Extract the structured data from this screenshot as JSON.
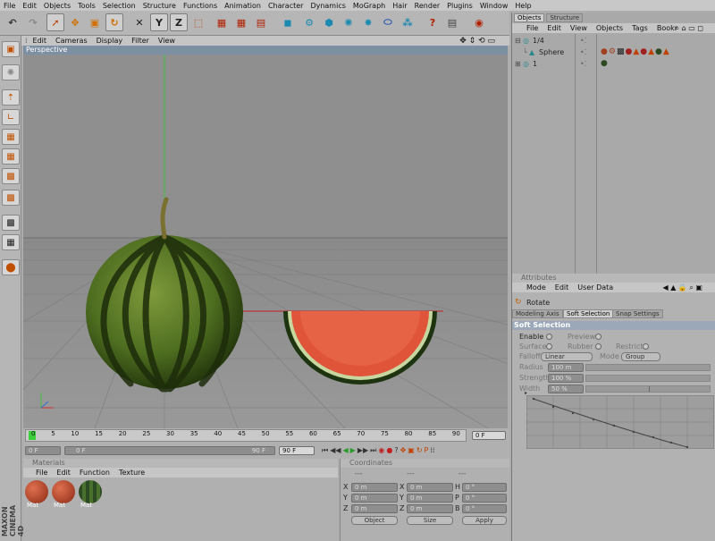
{
  "menu": [
    "File",
    "Edit",
    "Objects",
    "Tools",
    "Selection",
    "Structure",
    "Functions",
    "Animation",
    "Character",
    "Dynamics",
    "MoGraph",
    "Hair",
    "Render",
    "Plugins",
    "Window",
    "Help"
  ],
  "viewport": {
    "menu": [
      "Edit",
      "Cameras",
      "Display",
      "Filter",
      "View"
    ],
    "label": "Perspective"
  },
  "timeline": {
    "ticks": [
      "0",
      "5",
      "10",
      "15",
      "20",
      "25",
      "30",
      "35",
      "40",
      "45",
      "50",
      "55",
      "60",
      "65",
      "70",
      "75",
      "80",
      "85",
      "90"
    ],
    "current_frame": "0 F",
    "start_field": "0 F",
    "slider_left": "0 F",
    "slider_right": "90 F",
    "end_field": "90 F"
  },
  "materials": {
    "title": "Materials",
    "menu": [
      "File",
      "Edit",
      "Function",
      "Texture"
    ],
    "items": [
      {
        "label": "Mat",
        "color": "#b04a2a"
      },
      {
        "label": "Mat",
        "color": "#b04a2a"
      },
      {
        "label": "Mat",
        "color": "#2c4a22"
      }
    ]
  },
  "coordinates": {
    "title": "Coordinates",
    "header": [
      "---",
      "---",
      "---"
    ],
    "rows": [
      {
        "a": "X",
        "av": "0 m",
        "b": "X",
        "bv": "0 m",
        "c": "H",
        "cv": "0 °"
      },
      {
        "a": "Y",
        "av": "0 m",
        "b": "Y",
        "bv": "0 m",
        "c": "P",
        "cv": "0 °"
      },
      {
        "a": "Z",
        "av": "0 m",
        "b": "Z",
        "bv": "0 m",
        "c": "B",
        "cv": "0 °"
      }
    ],
    "mode1": "Object",
    "mode2": "Size",
    "apply": "Apply"
  },
  "objects": {
    "tabs": [
      "Objects",
      "Structure"
    ],
    "menu": [
      "File",
      "Edit",
      "View",
      "Objects",
      "Tags",
      "Bookr"
    ],
    "items": [
      {
        "name": "1/4"
      },
      {
        "name": "Sphere"
      },
      {
        "name": "1"
      }
    ]
  },
  "attributes": {
    "title": "Attributes",
    "menu": [
      "Mode",
      "Edit",
      "User Data"
    ],
    "tool": "Rotate",
    "tabs": [
      "Modeling Axis",
      "Soft Selection",
      "Snap Settings"
    ],
    "section": "Soft Selection",
    "enable": "Enable",
    "preview": "Preview",
    "surface": "Surface",
    "rubber": "Rubber",
    "restrict": "Restrict",
    "falloff_label": "Falloff",
    "falloff_value": "Linear",
    "mode_label": "Mode",
    "mode_value": "Group",
    "radius_label": "Radius",
    "radius_value": "100 m",
    "strength_label": "Strength",
    "strength_value": "100 %",
    "width_label": "Width",
    "width_value": "50 %"
  },
  "logo": {
    "line1": "MAXON",
    "line2": "CINEMA 4D"
  }
}
